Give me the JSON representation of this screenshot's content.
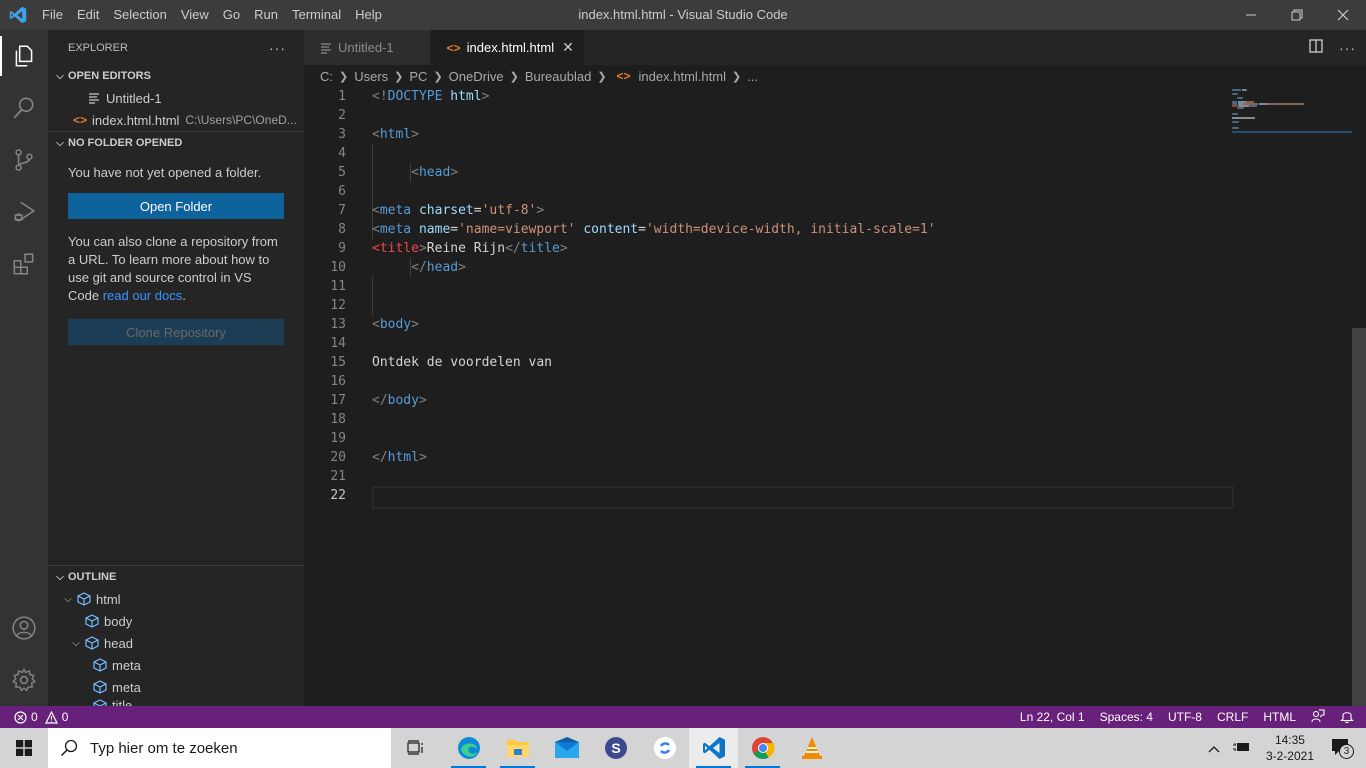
{
  "window": {
    "title": "index.html.html - Visual Studio Code",
    "menu": [
      "File",
      "Edit",
      "Selection",
      "View",
      "Go",
      "Run",
      "Terminal",
      "Help"
    ],
    "controls": [
      "minimize",
      "restore",
      "close"
    ]
  },
  "activity_bar": {
    "items": [
      {
        "name": "explorer-icon",
        "active": true
      },
      {
        "name": "search-icon"
      },
      {
        "name": "source-control-icon"
      },
      {
        "name": "run-debug-icon"
      },
      {
        "name": "extensions-icon"
      }
    ],
    "bottom": [
      {
        "name": "accounts-icon"
      },
      {
        "name": "settings-gear-icon"
      }
    ]
  },
  "sidebar": {
    "title": "EXPLORER",
    "more": "···",
    "open_editors": {
      "label": "OPEN EDITORS",
      "items": [
        {
          "name": "Untitled-1",
          "icon": "text-file-icon"
        },
        {
          "name": "index.html.html",
          "path": "C:\\Users\\PC\\OneD...",
          "icon": "html-file-icon"
        }
      ]
    },
    "no_folder": {
      "label": "NO FOLDER OPENED",
      "message": "You have not yet opened a folder.",
      "open_folder": "Open Folder",
      "clone_text": "You can also clone a repository from a URL. To learn more about how to use git and source control in VS Code ",
      "docs_link": "read our docs",
      "clone_text_end": ".",
      "clone_button": "Clone Repository"
    },
    "outline": {
      "label": "OUTLINE",
      "items": [
        {
          "label": "html",
          "depth": 0,
          "expanded": true
        },
        {
          "label": "body",
          "depth": 1
        },
        {
          "label": "head",
          "depth": 1,
          "expanded": true
        },
        {
          "label": "meta",
          "depth": 2
        },
        {
          "label": "meta",
          "depth": 2
        },
        {
          "label": "title",
          "depth": 2
        }
      ]
    }
  },
  "editor": {
    "tabs": [
      {
        "label": "Untitled-1",
        "active": false
      },
      {
        "label": "index.html.html",
        "active": true
      }
    ],
    "breadcrumb": [
      "C:",
      "Users",
      "PC",
      "OneDrive",
      "Bureaublad",
      "index.html.html",
      "..."
    ],
    "cursor_line": 22,
    "lines": [
      [
        [
          "t-br",
          "<!"
        ],
        [
          "t-tag",
          "DOCTYPE"
        ],
        [
          "t-txt",
          " "
        ],
        [
          "t-attr",
          "html"
        ],
        [
          "t-br",
          ">"
        ]
      ],
      [],
      [
        [
          "t-br",
          "<"
        ],
        [
          "t-tag",
          "html"
        ],
        [
          "t-br",
          ">"
        ]
      ],
      [],
      [
        [
          "t-txt",
          "     "
        ],
        [
          "t-br",
          "<"
        ],
        [
          "t-tag",
          "head"
        ],
        [
          "t-br",
          ">"
        ]
      ],
      [],
      [
        [
          "t-br",
          "<"
        ],
        [
          "t-tag",
          "meta"
        ],
        [
          "t-txt",
          " "
        ],
        [
          "t-attr",
          "charset"
        ],
        [
          "t-txt",
          "="
        ],
        [
          "t-str",
          "'utf-8'"
        ],
        [
          "t-br",
          ">"
        ]
      ],
      [
        [
          "t-br",
          "<"
        ],
        [
          "t-tag",
          "meta"
        ],
        [
          "t-txt",
          " "
        ],
        [
          "t-attr",
          "name"
        ],
        [
          "t-txt",
          "="
        ],
        [
          "t-str",
          "'name=viewport'"
        ],
        [
          "t-txt",
          " "
        ],
        [
          "t-attr",
          "content"
        ],
        [
          "t-txt",
          "="
        ],
        [
          "t-str",
          "'width=device-width, initial-scale=1'"
        ]
      ],
      [
        [
          "t-err",
          "<title"
        ],
        [
          "t-br",
          ">"
        ],
        [
          "t-txt",
          "Reine Rijn"
        ],
        [
          "t-br",
          "</"
        ],
        [
          "t-tag",
          "title"
        ],
        [
          "t-br",
          ">"
        ]
      ],
      [
        [
          "t-txt",
          "     "
        ],
        [
          "t-br",
          "</"
        ],
        [
          "t-tag",
          "head"
        ],
        [
          "t-br",
          ">"
        ]
      ],
      [],
      [],
      [
        [
          "t-br",
          "<"
        ],
        [
          "t-tag",
          "body"
        ],
        [
          "t-br",
          ">"
        ]
      ],
      [],
      [
        [
          "t-txt",
          "Ontdek de voordelen van"
        ]
      ],
      [],
      [
        [
          "t-br",
          "</"
        ],
        [
          "t-tag",
          "body"
        ],
        [
          "t-br",
          ">"
        ]
      ],
      [],
      [],
      [
        [
          "t-br",
          "</"
        ],
        [
          "t-tag",
          "html"
        ],
        [
          "t-br",
          ">"
        ]
      ],
      [],
      []
    ]
  },
  "statusbar": {
    "errors": "0",
    "warnings": "0",
    "position": "Ln 22, Col 1",
    "spaces": "Spaces: 4",
    "encoding": "UTF-8",
    "eol": "CRLF",
    "language": "HTML",
    "color": "#68217a"
  },
  "taskbar": {
    "search_placeholder": "Typ hier om te zoeken",
    "apps": [
      {
        "name": "edge-icon",
        "running": true
      },
      {
        "name": "file-explorer-icon",
        "running": true
      },
      {
        "name": "mail-icon"
      },
      {
        "name": "s-app-icon"
      },
      {
        "name": "sync-app-icon"
      },
      {
        "name": "vscode-icon",
        "running": true,
        "active": true
      },
      {
        "name": "chrome-icon",
        "running": true
      },
      {
        "name": "vlc-icon"
      }
    ],
    "time": "14:35",
    "date": "3-2-2021",
    "notifications": "3"
  }
}
